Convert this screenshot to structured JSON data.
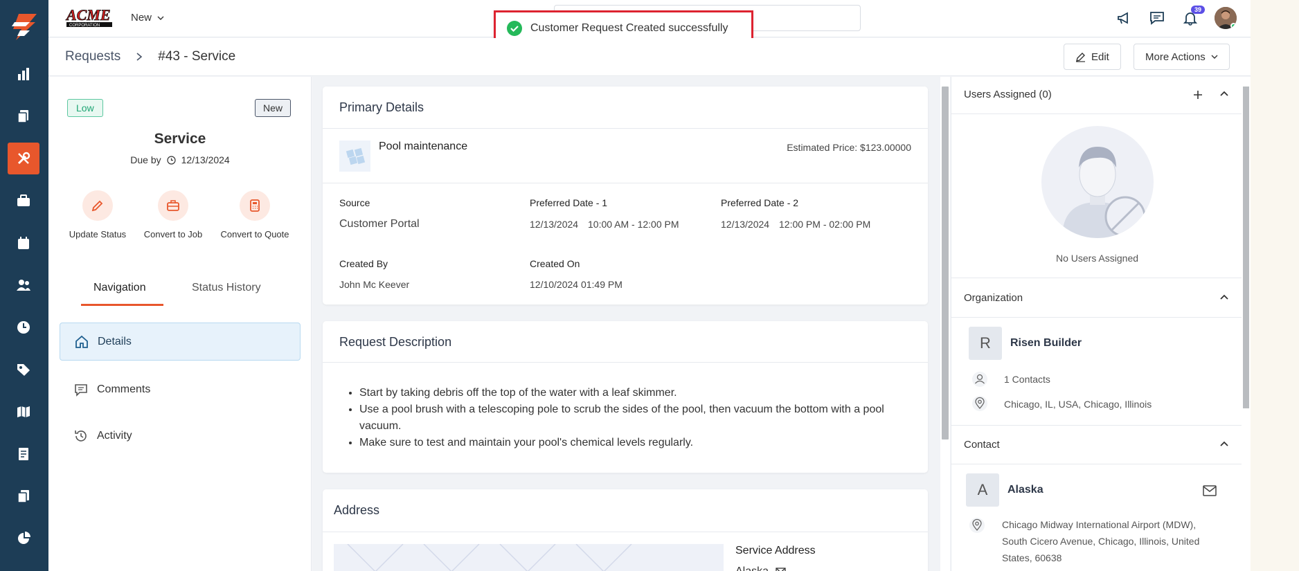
{
  "brand": {
    "name": "ACME",
    "sub": "CORPORATION"
  },
  "topbar": {
    "new_label": "New",
    "notif_count": "39"
  },
  "toast": {
    "message": "Customer Request Created successfully"
  },
  "breadcrumb": {
    "root": "Requests",
    "current": "#43 - Service"
  },
  "actions": {
    "edit": "Edit",
    "more": "More Actions"
  },
  "summary": {
    "priority": "Low",
    "status": "New",
    "title": "Service",
    "due_label": "Due by",
    "due_date": "12/13/2024",
    "quick_actions": [
      "Update Status",
      "Convert to Job",
      "Convert to Quote"
    ]
  },
  "left_tabs": {
    "navigation": "Navigation",
    "status_history": "Status History"
  },
  "left_nav": [
    "Details",
    "Comments",
    "Activity"
  ],
  "primary": {
    "heading": "Primary Details",
    "item_name": "Pool maintenance",
    "estimated_price": "Estimated Price: $123.00000",
    "source_label": "Source",
    "source": "Customer Portal",
    "pref1_label": "Preferred Date - 1",
    "pref1_date": "12/13/2024",
    "pref1_time": "10:00 AM - 12:00 PM",
    "pref2_label": "Preferred Date - 2",
    "pref2_date": "12/13/2024",
    "pref2_time": "12:00 PM - 02:00 PM",
    "created_by_label": "Created By",
    "created_by": "John Mc Keever",
    "created_on_label": "Created On",
    "created_on": "12/10/2024 01:49 PM"
  },
  "description": {
    "heading": "Request Description",
    "bullets": [
      "Start by taking debris off the top of the water with a leaf skimmer.",
      "Use a pool brush with a telescoping pole to scrub the sides of the pool, then vacuum the bottom with a pool vacuum.",
      "Make sure to test and maintain your pool's chemical levels regularly."
    ]
  },
  "address": {
    "heading": "Address",
    "service_label": "Service Address",
    "contact": "Alaska"
  },
  "users": {
    "heading": "Users Assigned (0)",
    "empty": "No Users Assigned"
  },
  "organization": {
    "heading": "Organization",
    "initial": "R",
    "name": "Risen Builder",
    "contacts": "1 Contacts",
    "location": "Chicago, IL, USA, Chicago, Illinois"
  },
  "contact": {
    "heading": "Contact",
    "initial": "A",
    "name": "Alaska",
    "address_l1": "Chicago Midway International Airport (MDW),",
    "address_l2": "South Cicero Avenue, Chicago, Illinois, United",
    "address_l3": "States, 60638"
  },
  "colors": {
    "rail": "#1d3d56",
    "accent": "#e8572c",
    "toast_border": "#dd2330",
    "success": "#25b95a"
  }
}
